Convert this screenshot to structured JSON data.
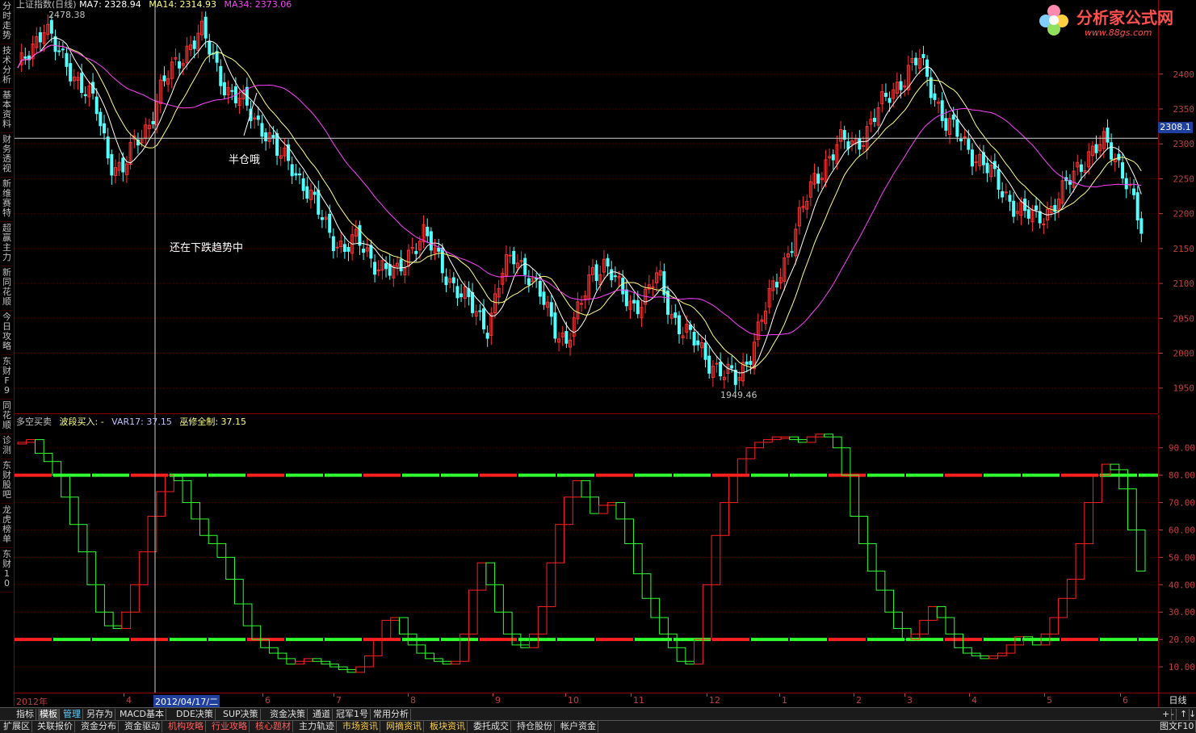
{
  "header": {
    "title": "上证指数(日线)",
    "ma7": "MA7: 2328.94",
    "ma14": "MA14: 2314.93",
    "ma34": "MA34: 2373.06",
    "high_label": "2478.38",
    "low_label": "1949.46",
    "crosshair_price": "2308.1"
  },
  "annotations": {
    "half_position": "半仓哦",
    "downtrend": "还在下跌趋势中"
  },
  "indicator": {
    "name": "多空买卖",
    "wave_buy": "波段买入: -",
    "var17": "VAR17: 37.15",
    "witch": "巫修全制: 37.15"
  },
  "logo": {
    "text": "分析家公式网",
    "url": "www.88gs.com"
  },
  "sidebar": [
    "分时走势",
    "技术分析",
    "基本资料",
    "财务透视",
    "新维赛特",
    "超赢主力",
    "新同花顺",
    "今日攻略",
    "东财F9",
    "同花顺",
    "诊测",
    "东财股吧",
    "龙虎榜单",
    "东财10"
  ],
  "price_axis": [
    "2400",
    "2350",
    "2300",
    "2250",
    "2200",
    "2150",
    "2100",
    "2050",
    "2000",
    "1950"
  ],
  "ind_axis": [
    "90.00",
    "80.00",
    "70.00",
    "60.00",
    "50.00",
    "40.00",
    "30.00",
    "20.00",
    "10.00"
  ],
  "time_axis": {
    "year": "2012年",
    "cursor_date": "2012/04/17/二",
    "months": [
      "4",
      "6",
      "7",
      "8",
      "9",
      "10",
      "11",
      "12",
      "1",
      "2",
      "3",
      "4",
      "5",
      "6"
    ],
    "period": "日线"
  },
  "toolbar1": [
    "指标",
    "模板",
    "管理",
    "另存为",
    "MACD基本",
    "DDE决策",
    "SUP决策",
    "资金决策",
    "通道",
    "冠军1号",
    "常用分析"
  ],
  "toolbar1_right": [
    "+",
    "-",
    "↑",
    "↓"
  ],
  "toolbar2": [
    "扩展区",
    "关联报价",
    "资金分布",
    "资金驱动",
    "机构攻略",
    "行业攻略",
    "核心题材",
    "主力轨迹",
    "市场资讯",
    "网摘资讯",
    "板块资讯",
    "委托成交",
    "持仓股份",
    "帐户资金"
  ],
  "toolbar2_right": "图文F10",
  "chart_data": [
    {
      "type": "candlestick",
      "title": "上证指数(日线)",
      "ylim": [
        1930,
        2490
      ],
      "high": 2478.38,
      "low": 1949.46,
      "crosshair": 2308.1,
      "ma_series": [
        {
          "name": "MA7",
          "color": "#ffffff",
          "last": 2328.94
        },
        {
          "name": "MA14",
          "color": "#ffff80",
          "last": 2314.93
        },
        {
          "name": "MA34",
          "color": "#ff40ff",
          "last": 2373.06
        }
      ],
      "close_path": [
        2400,
        2440,
        2470,
        2430,
        2410,
        2380,
        2350,
        2280,
        2260,
        2300,
        2330,
        2380,
        2410,
        2440,
        2460,
        2420,
        2380,
        2360,
        2340,
        2320,
        2280,
        2270,
        2240,
        2200,
        2170,
        2150,
        2160,
        2140,
        2120,
        2110,
        2150,
        2170,
        2140,
        2110,
        2080,
        2060,
        2040,
        2110,
        2140,
        2120,
        2080,
        2040,
        2020,
        2060,
        2120,
        2130,
        2090,
        2070,
        2080,
        2110,
        2060,
        2030,
        2010,
        1990,
        1970,
        1960,
        2000,
        2050,
        2100,
        2150,
        2200,
        2250,
        2280,
        2300,
        2300,
        2320,
        2350,
        2380,
        2400,
        2420,
        2380,
        2330,
        2310,
        2290,
        2270,
        2240,
        2220,
        2200,
        2190,
        2210,
        2230,
        2260,
        2290,
        2300,
        2280,
        2250,
        2170
      ],
      "colors": {
        "up": "#ff3232",
        "down": "#54ffff"
      }
    },
    {
      "type": "step-line",
      "title": "多空买卖",
      "ylim": [
        5,
        97
      ],
      "reference_lines": [
        80,
        20
      ],
      "values": [
        92,
        93,
        88,
        85,
        80,
        72,
        62,
        52,
        40,
        30,
        25,
        24,
        30,
        40,
        52,
        65,
        74,
        80,
        78,
        70,
        64,
        58,
        55,
        50,
        42,
        33,
        25,
        20,
        17,
        15,
        13,
        11,
        12,
        13,
        12,
        11,
        10,
        9,
        8,
        10,
        14,
        20,
        27,
        28,
        22,
        18,
        15,
        13,
        12,
        11,
        12,
        22,
        38,
        48,
        40,
        30,
        22,
        18,
        17,
        22,
        32,
        48,
        62,
        72,
        78,
        72,
        66,
        69,
        70,
        64,
        55,
        44,
        35,
        28,
        22,
        17,
        12,
        11,
        20,
        40,
        58,
        70,
        80,
        86,
        90,
        92,
        93,
        94,
        94,
        93,
        92,
        94,
        95,
        94,
        90,
        80,
        65,
        55,
        45,
        38,
        30,
        24,
        20,
        22,
        27,
        32,
        28,
        22,
        17,
        15,
        14,
        13,
        14,
        15,
        18,
        21,
        20,
        18,
        22,
        28,
        35,
        42,
        55,
        70,
        80,
        84,
        82,
        75,
        60,
        45
      ]
    }
  ]
}
